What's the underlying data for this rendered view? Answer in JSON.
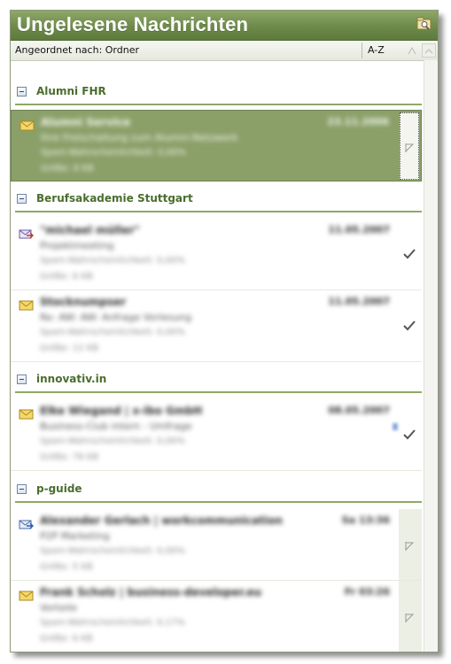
{
  "window": {
    "title": "Ungelesene Nachrichten"
  },
  "arrange": {
    "label": "Angeordnet nach: Ordner",
    "sort_label": "A-Z"
  },
  "groups": [
    {
      "name": "Alumni FHR",
      "items": [
        {
          "sender": "Alumni Service",
          "date": "23.11.2006",
          "subject": "Ihre Freischaltung zum Alumni-Netzwerk",
          "line3": "Spam-Wahrscheinlichkeit: 0,00%",
          "line4": "Größe: 8 KB",
          "icon": "envelope-icon",
          "status": "flag"
        }
      ]
    },
    {
      "name": "Berufsakademie Stuttgart",
      "items": [
        {
          "sender": "\"michael müller\"",
          "date": "11.05.2007",
          "subject": "Projektmeeting",
          "line3": "Spam-Wahrscheinlichkeit: 0,00%",
          "line4": "Größe: 6 KB",
          "icon": "forwarded-mail-icon",
          "status": "check"
        },
        {
          "sender": "Stocknumpser",
          "date": "11.05.2007",
          "subject": "Re: AW: AW: Anfrage Vorlesung",
          "line3": "Spam-Wahrscheinlichkeit: 0,00%",
          "line4": "Größe: 12 KB",
          "icon": "envelope-icon",
          "status": "check"
        }
      ]
    },
    {
      "name": "innovativ.in",
      "items": [
        {
          "sender": "Elke Wiegand | x-ibo GmbH",
          "date": "08.05.2007",
          "subject": "Business-Club intern - Umfrage",
          "line3": "Spam-Wahrscheinlichkeit: 0,00%",
          "line4": "Größe: 78 KB",
          "icon": "envelope-icon",
          "status": "check"
        }
      ]
    },
    {
      "name": "p-guide",
      "items": [
        {
          "sender": "Alexander Gerlach | workcommunication",
          "date": "Sa 13:36",
          "subject": "P2P Marketing",
          "line3": "Spam-Wahrscheinlichkeit: 0,00%",
          "line4": "Größe: 5 KB",
          "icon": "forwarded-mail-icon",
          "status": "flag"
        },
        {
          "sender": "Frank Scholz | business-developer.eu",
          "date": "Fr 03:26",
          "subject": "Vorteile",
          "line3": "Spam-Wahrscheinlichkeit: 0,17%",
          "line4": "Größe: 6 KB",
          "icon": "envelope-icon",
          "status": "flag"
        }
      ]
    }
  ],
  "colors": {
    "title_bar": "#6d8a4a",
    "group_text": "#4a6d2e",
    "group_rule": "#8daa62",
    "selection": "#8ba069"
  }
}
